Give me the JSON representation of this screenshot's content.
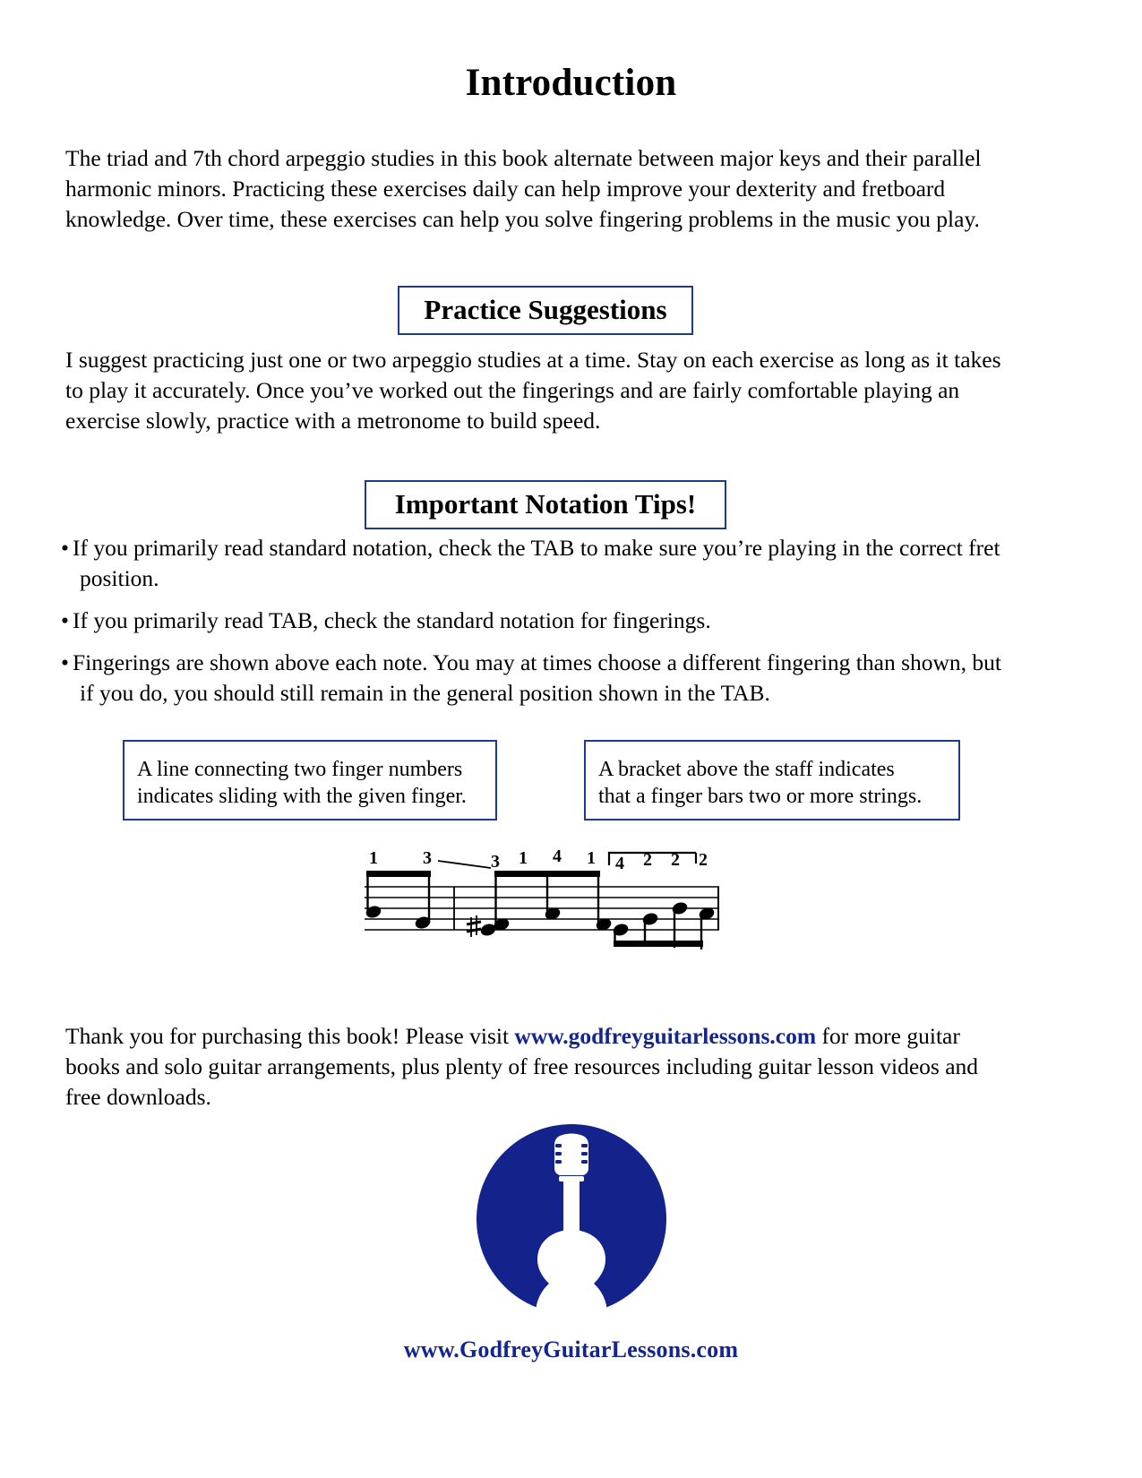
{
  "document": {
    "title": "Introduction"
  },
  "intro": {
    "paragraph": "The triad and 7th chord arpeggio studies in this book alternate between major keys and their parallel harmonic minors. Practicing these exercises daily can help improve your dexterity and fretboard knowledge. Over time, these exercises can help you solve fingering problems in the music you play."
  },
  "practice": {
    "heading": "Practice Suggestions",
    "paragraph": "I suggest practicing just one or two arpeggio studies at a time. Stay on each exercise as long as it takes to play it accurately. Once you’ve worked out the fingerings and are fairly comfortable playing an exercise slowly, practice with a metronome to build speed."
  },
  "tips": {
    "heading": "Important Notation Tips!",
    "bullet_marker": "•",
    "items": [
      {
        "line1": "If you primarily read standard notation, check the TAB to make sure you’re playing in the correct fret",
        "line2": "position."
      },
      {
        "line1": "If you primarily read TAB, check the standard notation for fingerings.",
        "line2": ""
      },
      {
        "line1": "Fingerings are shown above each note. You may at times choose a different fingering than shown, but",
        "line2": "if you do, you should still remain in the general position shown in the TAB."
      }
    ]
  },
  "callouts": {
    "slide": {
      "line1": "A line connecting two finger numbers",
      "line2": "indicates sliding with the given finger."
    },
    "barre": {
      "line1": "A bracket above the staff indicates",
      "line2": "that a finger bars two or more strings."
    }
  },
  "music_example": {
    "fingerings": [
      "1",
      "3",
      "3",
      "1",
      "4",
      "1",
      "4",
      "2",
      "2",
      "2"
    ],
    "accidental": "sharp",
    "has_slide_line": true,
    "has_barre_bracket": true,
    "staff_lines": 5
  },
  "footer": {
    "thanks_before": "Thank you for purchasing this book! Please visit ",
    "link": "www.godfreyguitarlessons.com",
    "thanks_after": " for more guitar books and solo guitar arrangements, plus plenty of free resources including guitar lesson videos and free downloads."
  },
  "logo": {
    "alt": "godfrey-guitar-lessons-logo",
    "circle_color": "#14228c",
    "guitar_color": "#ffffff"
  },
  "site": {
    "url": "www.GodfreyGuitarLessons.com",
    "color": "#14268c"
  }
}
